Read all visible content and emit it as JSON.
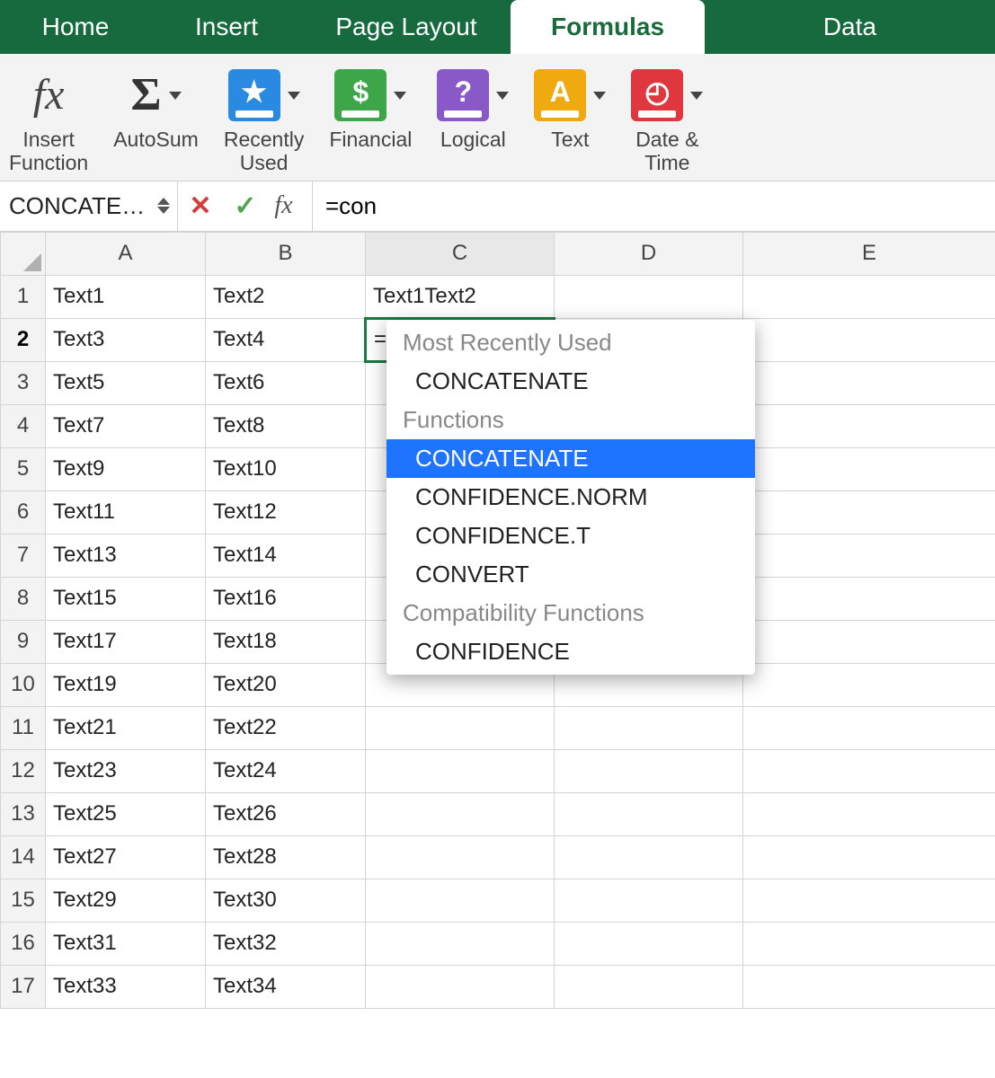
{
  "tabs": {
    "home": "Home",
    "insert": "Insert",
    "page_layout": "Page Layout",
    "formulas": "Formulas",
    "data": "Data"
  },
  "ribbon": {
    "insert_function": {
      "line1": "Insert",
      "line2": "Function",
      "glyph": "fx"
    },
    "autosum": {
      "label": "AutoSum",
      "glyph": "Σ"
    },
    "recently_used": {
      "line1": "Recently",
      "line2": "Used",
      "color": "#2a8ae2",
      "glyph": "★"
    },
    "financial": {
      "label": "Financial",
      "color": "#3da648",
      "glyph": "$"
    },
    "logical": {
      "label": "Logical",
      "color": "#8a59c8",
      "glyph": "?"
    },
    "text": {
      "label": "Text",
      "color": "#f0a90f",
      "glyph": "A"
    },
    "date_time": {
      "line1": "Date &",
      "line2": "Time",
      "color": "#e0373e",
      "glyph": "◔"
    }
  },
  "formula_bar": {
    "name_box": "CONCATE…",
    "fx_label": "fx",
    "input_value": "=con"
  },
  "columns": [
    "A",
    "B",
    "C",
    "D",
    "E"
  ],
  "active_cell": {
    "row": 2,
    "col": "C",
    "value": "=con"
  },
  "rows": [
    {
      "n": 1,
      "A": "Text1",
      "B": "Text2",
      "C": "Text1Text2"
    },
    {
      "n": 2,
      "A": "Text3",
      "B": "Text4",
      "C": "=con"
    },
    {
      "n": 3,
      "A": "Text5",
      "B": "Text6"
    },
    {
      "n": 4,
      "A": "Text7",
      "B": "Text8"
    },
    {
      "n": 5,
      "A": "Text9",
      "B": "Text10"
    },
    {
      "n": 6,
      "A": "Text11",
      "B": "Text12"
    },
    {
      "n": 7,
      "A": "Text13",
      "B": "Text14"
    },
    {
      "n": 8,
      "A": "Text15",
      "B": "Text16"
    },
    {
      "n": 9,
      "A": "Text17",
      "B": "Text18"
    },
    {
      "n": 10,
      "A": "Text19",
      "B": "Text20"
    },
    {
      "n": 11,
      "A": "Text21",
      "B": "Text22"
    },
    {
      "n": 12,
      "A": "Text23",
      "B": "Text24"
    },
    {
      "n": 13,
      "A": "Text25",
      "B": "Text26"
    },
    {
      "n": 14,
      "A": "Text27",
      "B": "Text28"
    },
    {
      "n": 15,
      "A": "Text29",
      "B": "Text30"
    },
    {
      "n": 16,
      "A": "Text31",
      "B": "Text32"
    },
    {
      "n": 17,
      "A": "Text33",
      "B": "Text34"
    }
  ],
  "autocomplete": {
    "sections": [
      {
        "title": "Most Recently Used",
        "items": [
          "CONCATENATE"
        ]
      },
      {
        "title": "Functions",
        "items": [
          "CONCATENATE",
          "CONFIDENCE.NORM",
          "CONFIDENCE.T",
          "CONVERT"
        ]
      },
      {
        "title": "Compatibility Functions",
        "items": [
          "CONFIDENCE"
        ]
      }
    ],
    "selected": "CONCATENATE",
    "selected_section": 1
  }
}
